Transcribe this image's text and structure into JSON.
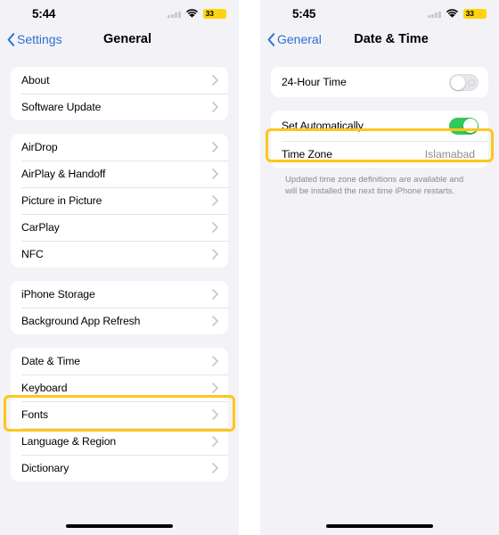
{
  "left_screen": {
    "status_bar": {
      "time": "5:44",
      "cellular_icon": "cellular-signal-icon",
      "wifi_icon": "wifi-icon",
      "battery_percent": "33",
      "battery_charging_glyph": "⚡",
      "battery_low_power_color": "#ffd60a"
    },
    "nav": {
      "back_label": "Settings",
      "back_icon": "chevron-left-icon",
      "title": "General"
    },
    "groups": [
      {
        "rows": [
          {
            "label": "About",
            "accessory": "chevron-right-icon"
          },
          {
            "label": "Software Update",
            "accessory": "chevron-right-icon"
          }
        ]
      },
      {
        "rows": [
          {
            "label": "AirDrop",
            "accessory": "chevron-right-icon"
          },
          {
            "label": "AirPlay & Handoff",
            "accessory": "chevron-right-icon"
          },
          {
            "label": "Picture in Picture",
            "accessory": "chevron-right-icon"
          },
          {
            "label": "CarPlay",
            "accessory": "chevron-right-icon"
          },
          {
            "label": "NFC",
            "accessory": "chevron-right-icon"
          }
        ]
      },
      {
        "rows": [
          {
            "label": "iPhone Storage",
            "accessory": "chevron-right-icon"
          },
          {
            "label": "Background App Refresh",
            "accessory": "chevron-right-icon"
          }
        ]
      },
      {
        "rows": [
          {
            "label": "Date & Time",
            "accessory": "chevron-right-icon",
            "highlighted": true
          },
          {
            "label": "Keyboard",
            "accessory": "chevron-right-icon"
          },
          {
            "label": "Fonts",
            "accessory": "chevron-right-icon"
          },
          {
            "label": "Language & Region",
            "accessory": "chevron-right-icon"
          },
          {
            "label": "Dictionary",
            "accessory": "chevron-right-icon"
          }
        ]
      }
    ]
  },
  "right_screen": {
    "status_bar": {
      "time": "5:45",
      "cellular_icon": "cellular-signal-icon",
      "wifi_icon": "wifi-icon",
      "battery_percent": "33",
      "battery_charging_glyph": "⚡",
      "battery_low_power_color": "#ffd60a"
    },
    "nav": {
      "back_label": "General",
      "back_icon": "chevron-left-icon",
      "title": "Date & Time"
    },
    "rows": {
      "hour_format": {
        "label": "24-Hour Time",
        "toggle_state": "off"
      },
      "set_automatically": {
        "label": "Set Automatically",
        "toggle_state": "on",
        "highlighted": true
      },
      "time_zone": {
        "label": "Time Zone",
        "value": "Islamabad"
      }
    },
    "footnote": "Updated time zone definitions are available and will be installed the next time iPhone restarts."
  },
  "colors": {
    "accent_blue": "#2f6fd0",
    "toggle_on_green": "#34c759",
    "highlight_yellow": "#ffc61a",
    "background_gray": "#f2f2f7",
    "secondary_text": "#8e8e93"
  }
}
